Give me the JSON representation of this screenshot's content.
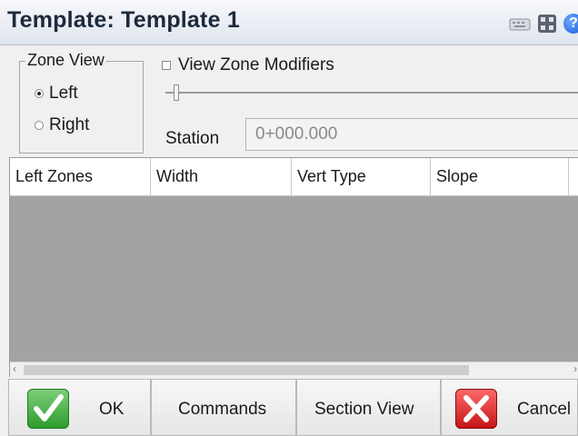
{
  "titlebar": {
    "title": "Template: Template 1",
    "icons": [
      "keyboard-icon",
      "calculator-icon",
      "help-icon"
    ],
    "help_glyph": "?"
  },
  "zone_view": {
    "legend": "Zone View",
    "options": [
      {
        "label": "Left",
        "selected": true
      },
      {
        "label": "Right",
        "selected": false
      }
    ]
  },
  "modifiers": {
    "label": "View Zone Modifiers",
    "checked": false,
    "slider_fraction": 0.02
  },
  "station": {
    "label": "Station",
    "value": "0+000.000"
  },
  "table": {
    "columns": [
      "Left Zones",
      "Width",
      "Vert Type",
      "Slope"
    ],
    "rows": []
  },
  "buttons": {
    "ok": "OK",
    "commands": "Commands",
    "section_view": "Section View",
    "cancel": "Cancel"
  },
  "colors": {
    "table_background": "#a3a3a3",
    "ok_green": "#2c9a2b",
    "cancel_red": "#c31313",
    "title_text": "#1c2a3c"
  }
}
